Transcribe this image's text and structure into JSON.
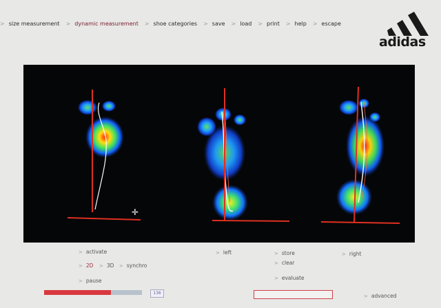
{
  "nav": {
    "items": [
      {
        "label": "size measurement",
        "active": false
      },
      {
        "label": "dynamic measurement",
        "active": true
      },
      {
        "label": "shoe categories",
        "active": false
      },
      {
        "label": "save",
        "active": false
      },
      {
        "label": "load",
        "active": false
      },
      {
        "label": "print",
        "active": false
      },
      {
        "label": "help",
        "active": false
      },
      {
        "label": "escape",
        "active": false
      }
    ]
  },
  "brand": {
    "logo_text": "adidas"
  },
  "controls": {
    "separator": ">",
    "activate": "activate",
    "view_2d": "2D",
    "view_3d": "3D",
    "synchro": "synchro",
    "pause": "pause",
    "left": "left",
    "store": "store",
    "clear": "clear",
    "evaluate": "evaluate",
    "right": "right",
    "advanced": "advanced"
  },
  "playback": {
    "frame_counter": "136",
    "progress": 0.68
  },
  "colors": {
    "accent": "#d8393f",
    "active_text": "#7a2030",
    "scan_bg": "#050608",
    "axis_line": "#e03020"
  }
}
